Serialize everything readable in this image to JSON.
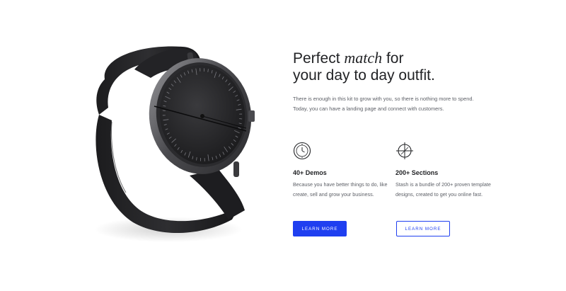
{
  "hero": {
    "headline_part1": "Perfect ",
    "headline_emphasis": "match",
    "headline_part2": " for",
    "headline_line2": "your day to day outfit.",
    "intro_line1": "There is enough in this kit to grow with you, so there is nothing more to spend.",
    "intro_line2": "Today, you can have a landing page and connect with customers."
  },
  "features": [
    {
      "icon": "clock-icon",
      "title": "40+ Demos",
      "text": "Because you have better things to do, like create, sell and grow your business.",
      "button_label": "LEARN MORE",
      "button_style": "primary"
    },
    {
      "icon": "crosshair-icon",
      "title": "200+ Sections",
      "text": "Stash is a bundle of 200+ proven template designs, created to get you online fast.",
      "button_label": "LEARN MORE",
      "button_style": "outline"
    }
  ],
  "colors": {
    "accent": "#1f3ff0",
    "heading": "#222326",
    "body_text": "#5c5f66",
    "background": "#ffffff"
  }
}
